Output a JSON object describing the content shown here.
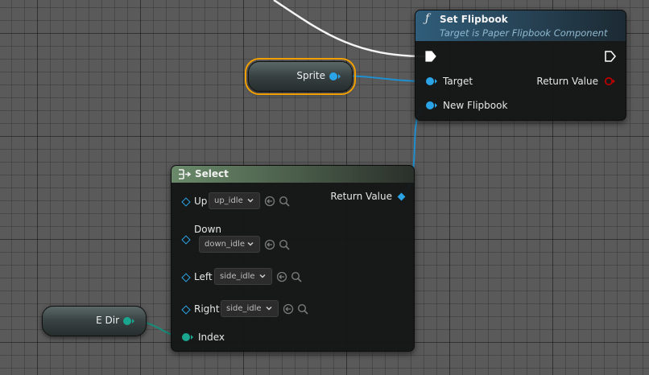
{
  "colors": {
    "object_pin": "#2aa4e6",
    "enum_pin": "#1aa58e",
    "return_pin": "#b80000",
    "exec_pin": "#ffffff",
    "selection": "#f2a000"
  },
  "set_flipbook": {
    "title": "Set Flipbook",
    "subtitle": "Target is Paper Flipbook Component",
    "icon": "function-icon",
    "inputs": {
      "target": "Target",
      "new_flipbook": "New Flipbook"
    },
    "outputs": {
      "return_value": "Return Value"
    }
  },
  "sprite_var": {
    "label": "Sprite"
  },
  "select": {
    "title": "Select",
    "icon": "select-icon",
    "return_value": "Return Value",
    "options": [
      {
        "label": "Up",
        "value": "up_idle"
      },
      {
        "label": "Down",
        "value": "down_idle"
      },
      {
        "label": "Left",
        "value": "side_idle"
      },
      {
        "label": "Right",
        "value": "side_idle"
      }
    ],
    "index_label": "Index"
  },
  "edir_var": {
    "label": "E Dir"
  }
}
